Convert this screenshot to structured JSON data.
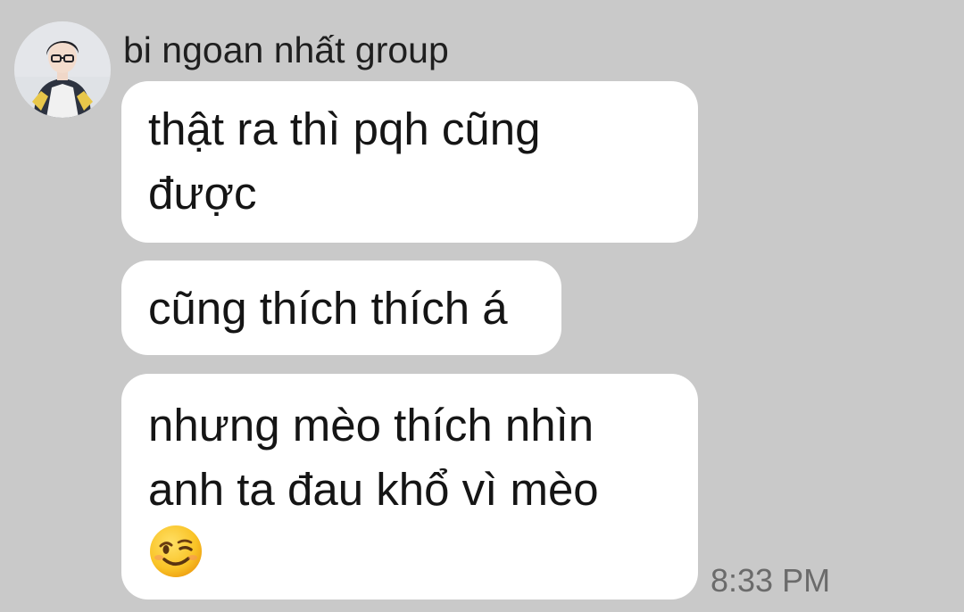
{
  "sender": {
    "name": "bi ngoan nhất group",
    "avatar_icon": "profile-photo"
  },
  "messages": [
    {
      "lines": [
        "thật ra thì pqh cũng",
        "được"
      ]
    },
    {
      "lines": [
        "cũng thích thích á"
      ]
    },
    {
      "lines": [
        "nhưng mèo thích nhìn",
        "anh ta đau khổ vì mèo"
      ],
      "emoji": "winking-face-emoji"
    }
  ],
  "timestamp": "8:33 PM",
  "colors": {
    "background": "#c9c9c9",
    "bubble": "#ffffff",
    "text": "#151515",
    "timestamp": "#6b6b6b"
  }
}
